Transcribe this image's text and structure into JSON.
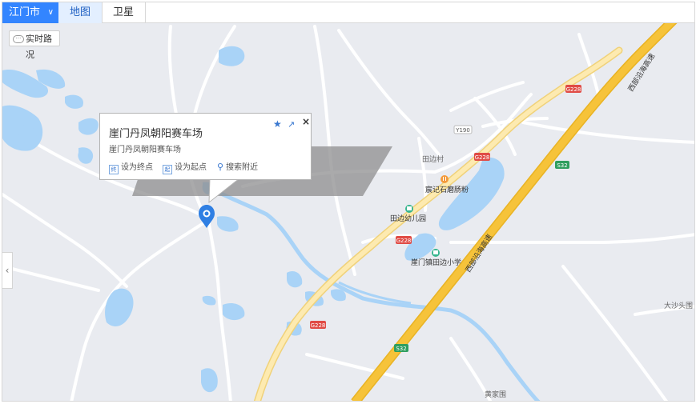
{
  "toolbar": {
    "city": "江门市",
    "map_tab": "地图",
    "satellite_tab": "卫星",
    "traffic": "实时路况"
  },
  "popup": {
    "title": "崖门丹凤朝阳赛车场",
    "address": "崖门丹凤朝阳赛车场",
    "set_end": "设为终点",
    "set_start": "设为起点",
    "search_nearby": "搜索附近",
    "end_icon_char": "终",
    "start_icon_char": "起"
  },
  "labels": {
    "tianbian_village": "田边村",
    "restaurant": "宸记石磨肠粉",
    "kindergarten": "田边幼儿园",
    "primary_school": "崖门镇田边小学",
    "dasha": "大沙头围",
    "huangjiawei": "黄家围",
    "expressway_upper": "西部沿海高速",
    "expressway_lower": "西部沿海高速",
    "y190": "Y190",
    "g228_a": "G228",
    "g228_b": "G228",
    "g228_c": "G228",
    "g228_d": "G228",
    "s32_a": "S32",
    "s32_b": "S32"
  },
  "colors": {
    "map_bg": "#e9ebf0",
    "water": "#a9d3f7",
    "expressway": "#f6c33a",
    "national_road": "#fde9a6",
    "accent": "#3385ff"
  }
}
